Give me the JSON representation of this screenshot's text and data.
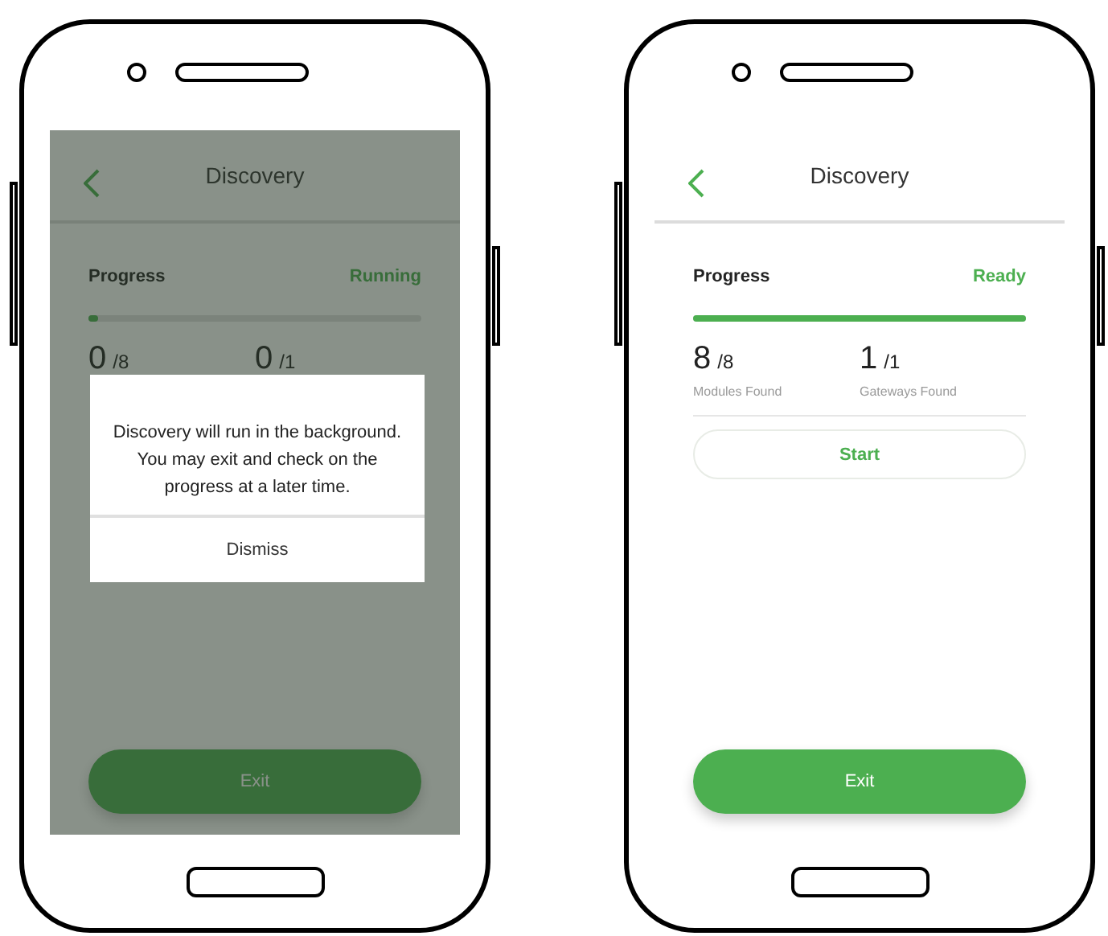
{
  "phones": [
    {
      "title": "Discovery",
      "progress_label": "Progress",
      "status": "Running",
      "level": 0.03,
      "counts": [
        {
          "found": "0",
          "total": "/8"
        },
        {
          "found": "0",
          "total": "/1"
        }
      ],
      "exit_button": "Exit",
      "dialog": {
        "message": "Discovery will run in the background. You may exit and check on the progress at a later time.",
        "button": "Dismiss"
      }
    },
    {
      "title": "Discovery",
      "progress_label": "Progress",
      "status": "Ready",
      "level": 1,
      "counts": [
        {
          "found": "8",
          "total": "/8",
          "label": "Modules Found"
        },
        {
          "found": "1",
          "total": "/1",
          "label": "Gateways Found"
        }
      ],
      "start_button": "Start",
      "exit_button": "Exit"
    }
  ]
}
